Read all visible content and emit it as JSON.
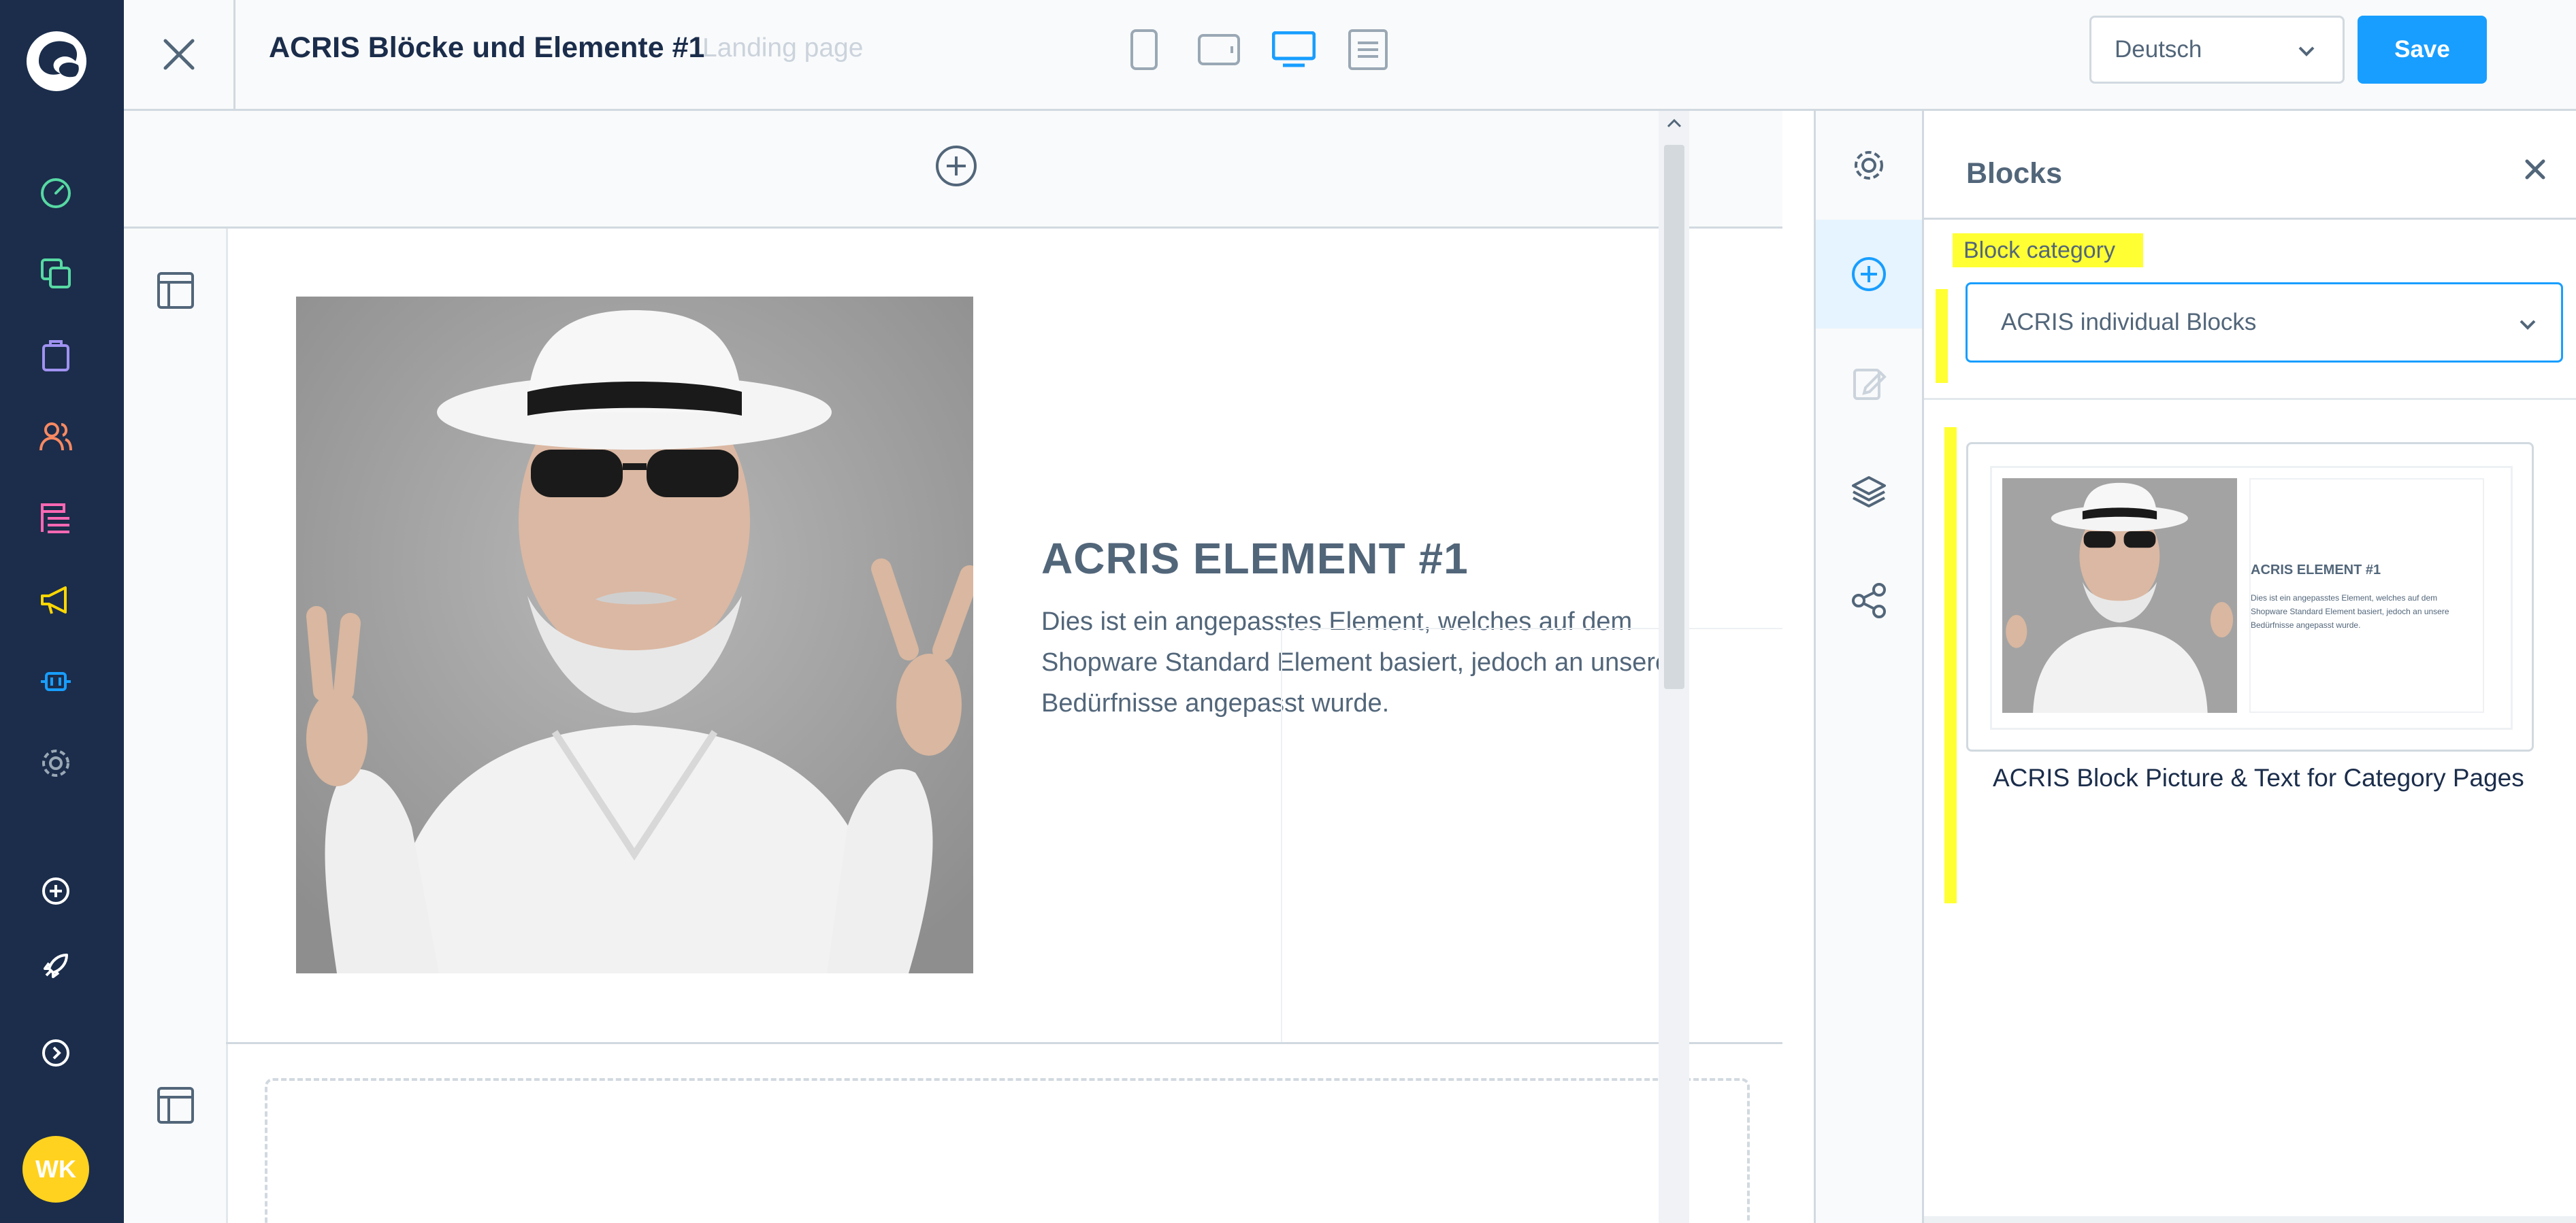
{
  "app": {
    "user_initials": "WK"
  },
  "nav_items": [
    {
      "icon": "dashboard-icon",
      "color": "#57d9a3"
    },
    {
      "icon": "catalogue-icon",
      "color": "#57d9a3"
    },
    {
      "icon": "orders-icon",
      "color": "#a092f0"
    },
    {
      "icon": "customers-icon",
      "color": "#f88962"
    },
    {
      "icon": "content-icon",
      "color": "#ff68b4"
    },
    {
      "icon": "marketing-icon",
      "color": "#ffd700"
    },
    {
      "icon": "extensions-icon",
      "color": "#189eff"
    },
    {
      "icon": "settings-icon",
      "color": "#9aa8b5"
    },
    {
      "icon": "plus-circle-icon",
      "color": "#ffffff"
    },
    {
      "icon": "rocket-icon",
      "color": "#ffffff"
    },
    {
      "icon": "expand-icon",
      "color": "#ffffff"
    }
  ],
  "header": {
    "title": "ACRIS Blöcke und Elemente #1",
    "subtitle": "Landing page",
    "language": "Deutsch",
    "save_label": "Save",
    "devices": [
      "mobile",
      "tablet",
      "desktop",
      "form"
    ],
    "active_device": "desktop"
  },
  "canvas": {
    "element_title": "ACRIS ELEMENT #1",
    "element_text": "Dies ist ein angepasstes Element, welches auf dem Shopware Standard Element basiert, jedoch an unsere Bedürfnisse angepasst wurde."
  },
  "tools": [
    "settings-icon",
    "add-block-icon",
    "edit-icon",
    "layers-icon",
    "share-icon"
  ],
  "panel": {
    "title": "Blocks",
    "category_label": "Block category",
    "category_value": "ACRIS individual Blocks",
    "block_name": "ACRIS Block Picture & Text for Category Pages",
    "preview_title": "ACRIS ELEMENT #1",
    "preview_text": "Dies ist ein angepasstes Element, welches auf dem Shopware Standard Element basiert, jedoch an unsere Bedürfnisse angepasst wurde."
  },
  "colors": {
    "rail": "#1b2d4b",
    "accent": "#189eff",
    "highlight": "#ffff33",
    "avatar": "#ffd21f"
  }
}
